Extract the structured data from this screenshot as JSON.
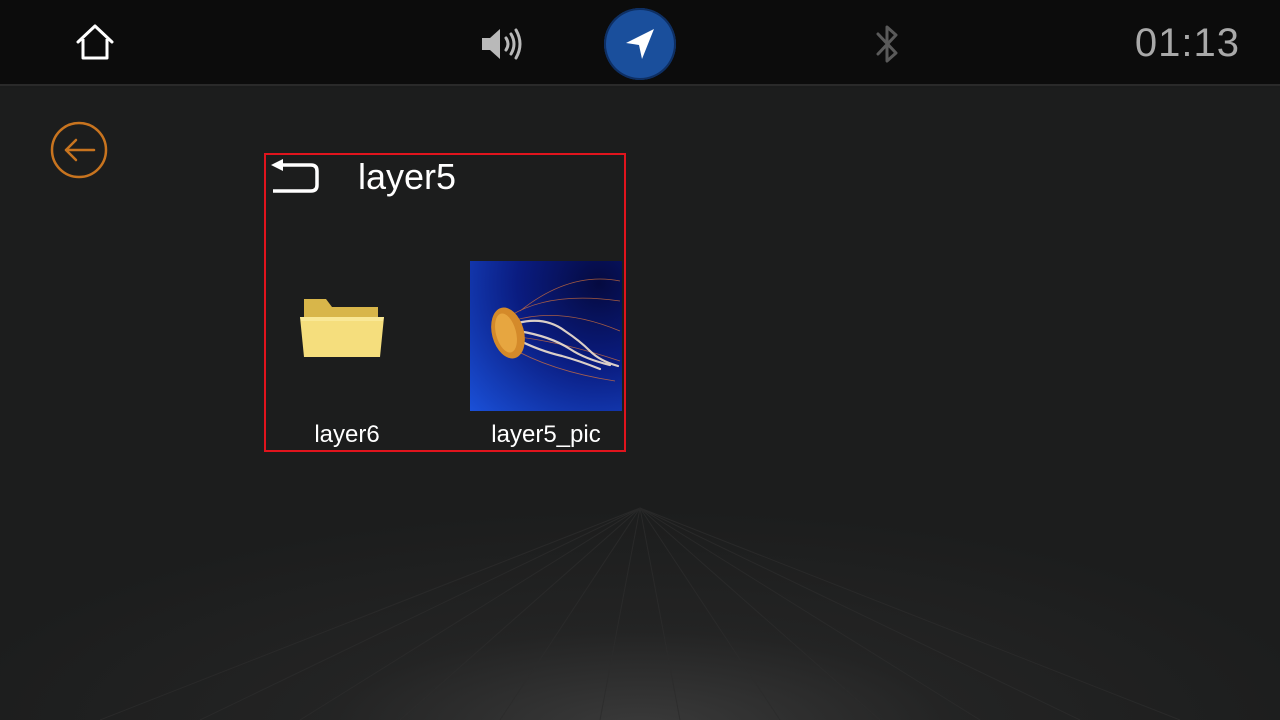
{
  "status_bar": {
    "home_icon": "home-icon",
    "volume_icon": "volume-icon",
    "navigation_icon": "navigation-arrow-icon",
    "bluetooth_icon": "bluetooth-icon",
    "time": "01:13"
  },
  "back_button": {
    "icon": "back-arrow-icon",
    "color": "#c8741f"
  },
  "file_browser": {
    "up_icon": "return-icon",
    "folder_name": "layer5",
    "items": [
      {
        "label": "layer6",
        "kind": "folder",
        "icon": "folder-icon"
      },
      {
        "label": "layer5_pic",
        "kind": "image",
        "icon": "jellyfish-thumbnail"
      }
    ],
    "highlight_color": "#e0141d"
  },
  "colors": {
    "status_bg": "#0c0c0c",
    "content_bg": "#1c1d1d",
    "nav_accent": "#1a4f9c",
    "clock_text": "#a9a9a9"
  }
}
